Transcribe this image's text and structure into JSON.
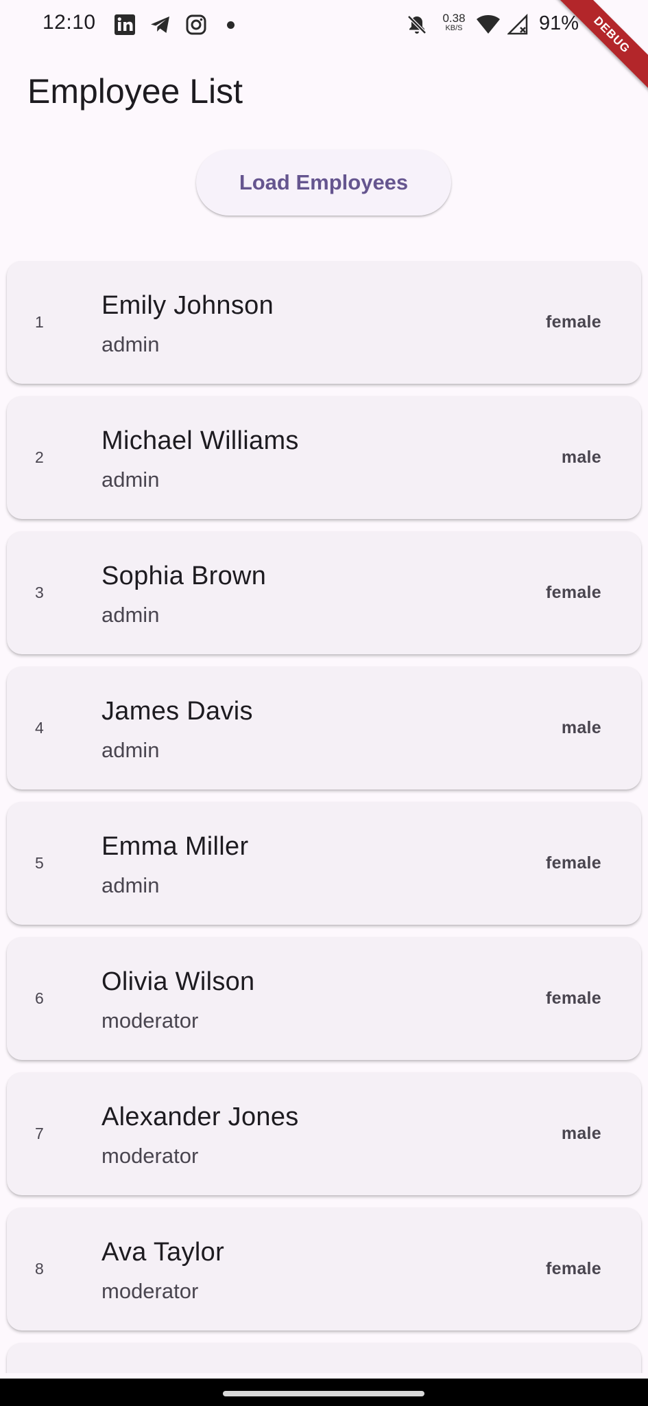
{
  "status_bar": {
    "time": "12:10",
    "net_speed_value": "0.38",
    "net_speed_unit": "KB/S",
    "battery_percent": "91%",
    "icons": [
      "linkedin-icon",
      "telegram-icon",
      "instagram-icon",
      "notification-dot",
      "notifications-muted-icon",
      "wifi-icon",
      "no-signal-icon",
      "battery-icon"
    ]
  },
  "debug_banner": "DEBUG",
  "app_bar": {
    "title": "Employee List"
  },
  "actions": {
    "load_label": "Load Employees"
  },
  "employees": [
    {
      "index": "1",
      "name": "Emily Johnson",
      "role": "admin",
      "gender": "female"
    },
    {
      "index": "2",
      "name": "Michael Williams",
      "role": "admin",
      "gender": "male"
    },
    {
      "index": "3",
      "name": "Sophia Brown",
      "role": "admin",
      "gender": "female"
    },
    {
      "index": "4",
      "name": "James Davis",
      "role": "admin",
      "gender": "male"
    },
    {
      "index": "5",
      "name": "Emma Miller",
      "role": "admin",
      "gender": "female"
    },
    {
      "index": "6",
      "name": "Olivia Wilson",
      "role": "moderator",
      "gender": "female"
    },
    {
      "index": "7",
      "name": "Alexander Jones",
      "role": "moderator",
      "gender": "male"
    },
    {
      "index": "8",
      "name": "Ava Taylor",
      "role": "moderator",
      "gender": "female"
    },
    {
      "index": "",
      "name": "",
      "role": "",
      "gender": ""
    }
  ],
  "colors": {
    "background": "#fdf8fd",
    "card": "#f5f0f6",
    "primary": "#65558f",
    "on_surface": "#1d1b20",
    "on_surface_variant": "#49454f",
    "debug_ribbon": "#b3262a"
  }
}
